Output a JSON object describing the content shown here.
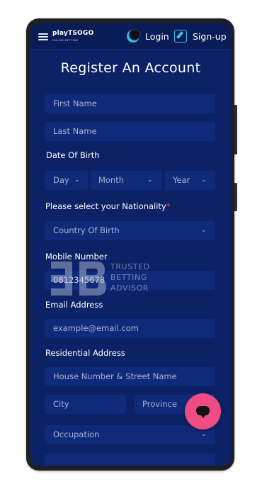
{
  "header": {
    "logo_text": "playTSOGO",
    "logo_subtext": "ONLINE BETTING",
    "login_label": "Login",
    "signup_label": "Sign-up"
  },
  "form": {
    "title": "Register An Account",
    "first_name_placeholder": "First Name",
    "last_name_placeholder": "Last Name",
    "dob_label": "Date Of Birth",
    "day_placeholder": "Day",
    "month_placeholder": "Month",
    "year_placeholder": "Year",
    "nationality_label": "Please select your Nationality",
    "required_marker": "*",
    "country_placeholder": "Country Of Birth",
    "mobile_label": "Mobile Number",
    "mobile_value": "0812345678",
    "email_label": "Email Address",
    "email_placeholder": "example@email.com",
    "address_label": "Residential Address",
    "street_placeholder": "House Number & Street Name",
    "city_placeholder": "City",
    "province_placeholder": "Province",
    "occupation_placeholder": "Occupation"
  },
  "watermark": {
    "line1": "TRUSTED",
    "line2": "BETTING",
    "line3": "ADVISOR"
  },
  "icons": {
    "menu": "hamburger-menu-icon",
    "login": "login-icon",
    "signup": "signup-icon",
    "dropdown": "chevron-down-icon",
    "chat": "chat-icon"
  },
  "colors": {
    "background": "#0c2266",
    "field": "#0f2a78",
    "accent": "#39c2ee",
    "chat_button": "#ee4c82",
    "required": "#e83a4f"
  }
}
